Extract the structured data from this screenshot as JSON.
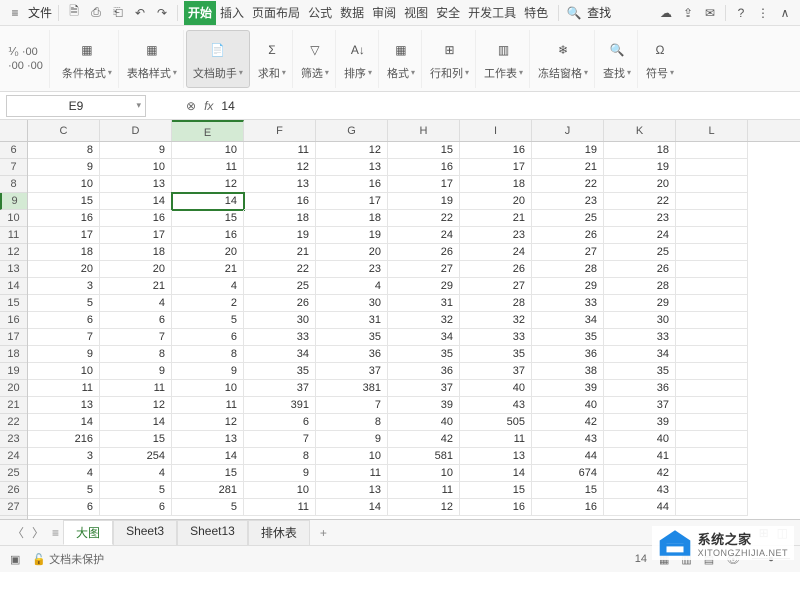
{
  "menubar": {
    "file": "文件",
    "find": "查找"
  },
  "tabs": [
    "开始",
    "插入",
    "页面布局",
    "公式",
    "数据",
    "审阅",
    "视图",
    "安全",
    "开发工具",
    "特色"
  ],
  "active_tab": 0,
  "ribbon_left": [
    "⅟₀",
    "·00",
    "·00",
    "·00"
  ],
  "ribbon": [
    {
      "label": "条件格式",
      "glyph": "▦"
    },
    {
      "label": "表格样式",
      "glyph": "▦"
    },
    {
      "label": "文档助手",
      "glyph": "📄",
      "selected": true
    },
    {
      "label": "求和",
      "glyph": "Σ"
    },
    {
      "label": "筛选",
      "glyph": "▽"
    },
    {
      "label": "排序",
      "glyph": "A↓"
    },
    {
      "label": "格式",
      "glyph": "▦"
    },
    {
      "label": "行和列",
      "glyph": "⊞"
    },
    {
      "label": "工作表",
      "glyph": "▥"
    },
    {
      "label": "冻结窗格",
      "glyph": "❄"
    },
    {
      "label": "查找",
      "glyph": "🔍"
    },
    {
      "label": "符号",
      "glyph": "Ω"
    }
  ],
  "cell_ref": "E9",
  "formula_value": "14",
  "columns": [
    "C",
    "D",
    "E",
    "F",
    "G",
    "H",
    "I",
    "J",
    "K",
    "L"
  ],
  "active_col_index": 2,
  "row_start": 6,
  "active_row": 9,
  "chart_data": {
    "type": "table",
    "columns": [
      "C",
      "D",
      "E",
      "F",
      "G",
      "H",
      "I",
      "J",
      "K"
    ],
    "rows_index": [
      6,
      7,
      8,
      9,
      10,
      11,
      12,
      13,
      14,
      15,
      16,
      17,
      18,
      19,
      20,
      21,
      22,
      23,
      24,
      25,
      26,
      27
    ],
    "values": [
      [
        8,
        9,
        10,
        11,
        12,
        15,
        16,
        19,
        18
      ],
      [
        9,
        10,
        11,
        12,
        13,
        16,
        17,
        21,
        19
      ],
      [
        10,
        13,
        12,
        13,
        16,
        17,
        18,
        22,
        20
      ],
      [
        15,
        14,
        14,
        16,
        17,
        19,
        20,
        23,
        22
      ],
      [
        16,
        16,
        15,
        18,
        18,
        22,
        21,
        25,
        23
      ],
      [
        17,
        17,
        16,
        19,
        19,
        24,
        23,
        26,
        24
      ],
      [
        18,
        18,
        20,
        21,
        20,
        26,
        24,
        27,
        25
      ],
      [
        20,
        20,
        21,
        22,
        23,
        27,
        26,
        28,
        26
      ],
      [
        3,
        21,
        4,
        25,
        4,
        29,
        27,
        29,
        28
      ],
      [
        5,
        4,
        2,
        26,
        30,
        31,
        28,
        33,
        29
      ],
      [
        6,
        6,
        5,
        30,
        31,
        32,
        32,
        34,
        30
      ],
      [
        7,
        7,
        6,
        33,
        35,
        34,
        33,
        35,
        33
      ],
      [
        9,
        8,
        8,
        34,
        36,
        35,
        35,
        36,
        34
      ],
      [
        10,
        9,
        9,
        35,
        37,
        36,
        37,
        38,
        35
      ],
      [
        11,
        11,
        10,
        37,
        381,
        37,
        40,
        39,
        36
      ],
      [
        13,
        12,
        11,
        391,
        7,
        39,
        43,
        40,
        37
      ],
      [
        14,
        14,
        12,
        6,
        8,
        40,
        505,
        42,
        39
      ],
      [
        216,
        15,
        13,
        7,
        9,
        42,
        11,
        43,
        40
      ],
      [
        3,
        254,
        14,
        8,
        10,
        581,
        13,
        44,
        41
      ],
      [
        4,
        4,
        15,
        9,
        11,
        10,
        14,
        674,
        42
      ],
      [
        5,
        5,
        281,
        10,
        13,
        11,
        15,
        15,
        43
      ],
      [
        6,
        6,
        5,
        11,
        14,
        12,
        16,
        16,
        44
      ]
    ]
  },
  "sheet_tabs": [
    "大图",
    "Sheet3",
    "Sheet13",
    "排休表"
  ],
  "active_sheet": 0,
  "status": {
    "protect": "文档未保护",
    "value": "14"
  },
  "watermark": {
    "title": "系统之家",
    "sub": "XITONGZHIJIA.NET"
  }
}
